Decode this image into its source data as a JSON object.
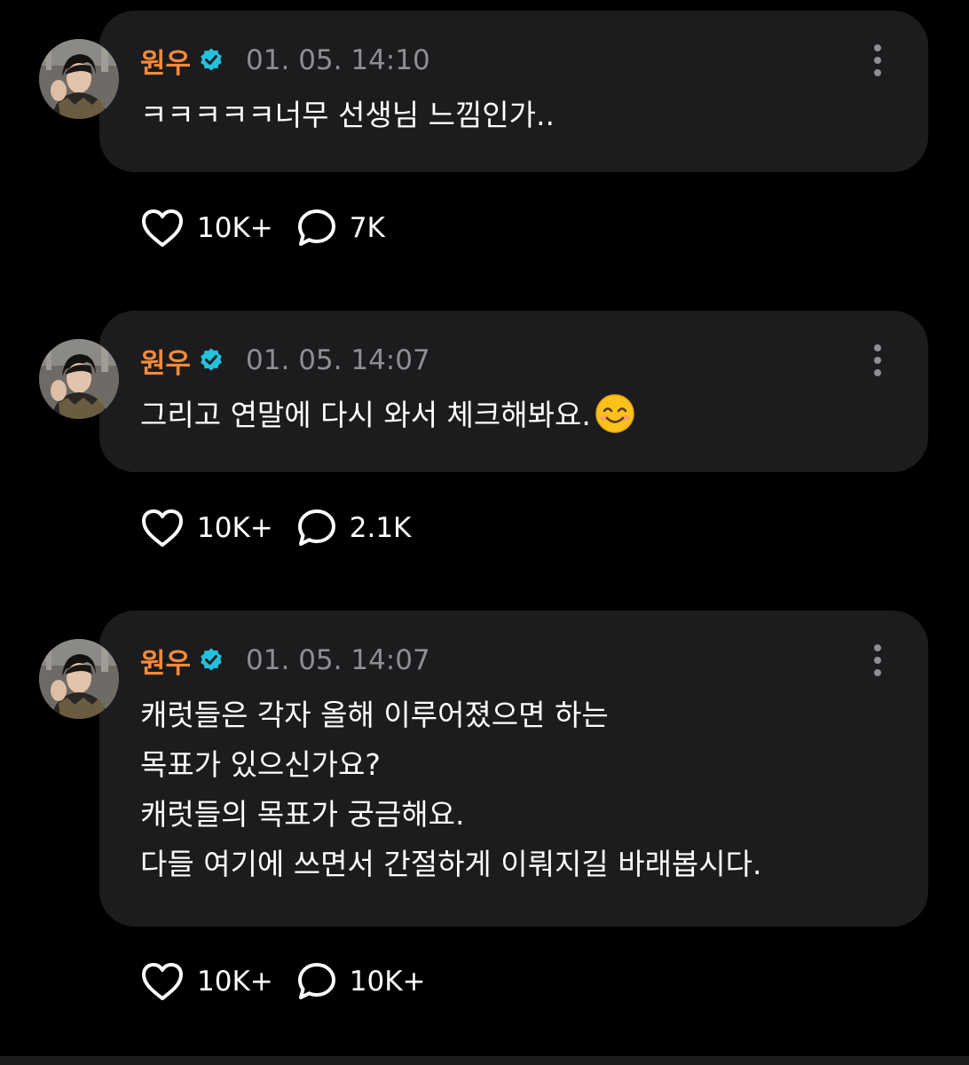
{
  "posts": [
    {
      "author": "원우",
      "time": "01. 05. 14:10",
      "lines": [
        "ㅋㅋㅋㅋㅋ너무 선생님 느낌인가.."
      ],
      "likes": "10K+",
      "comments": "7K"
    },
    {
      "author": "원우",
      "time": "01. 05. 14:07",
      "lines": [
        "그리고 연말에 다시 와서 체크해봐요."
      ],
      "emoji": "smiling-face-emoji",
      "likes": "10K+",
      "comments": "2.1K"
    },
    {
      "author": "원우",
      "time": "01. 05. 14:07",
      "lines": [
        "캐럿들은 각자 올해 이루어졌으면 하는",
        "목표가 있으신가요?",
        "캐럿들의 목표가 궁금해요.",
        "다들 여기에 쓰면서 간절하게 이뤄지길 바래봅시다."
      ],
      "likes": "10K+",
      "comments": "10K+"
    }
  ],
  "icons": {
    "verified": "verified-badge-icon",
    "like": "heart-icon",
    "comment": "comment-bubble-icon",
    "more": "more-vertical-icon"
  },
  "colors": {
    "background": "#000000",
    "bubble": "#1c1c1e",
    "author": "#f58a3c",
    "verified": "#23c1dc",
    "timestamp": "#8e8e93",
    "text": "#ffffff"
  }
}
